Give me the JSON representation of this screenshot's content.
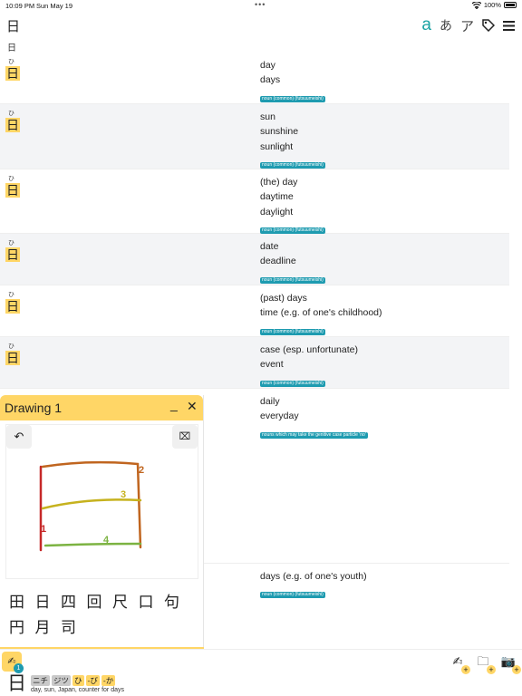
{
  "status": {
    "time": "10:09 PM",
    "date": "Sun May 19",
    "dots": "•••",
    "battery": "100%"
  },
  "toolbar": {
    "title": "日",
    "romaji": "a",
    "hiragana": "あ",
    "katakana": "ア",
    "tag": "⌗",
    "menu": "≡"
  },
  "query": "日",
  "results": [
    {
      "reading": "ひ",
      "kanji": "日",
      "glosses": [
        "day",
        "days"
      ],
      "pos": "noun (common) (futsuumeishi)"
    },
    {
      "reading": "ひ",
      "kanji": "日",
      "glosses": [
        "sun",
        "sunshine",
        "sunlight"
      ],
      "pos": "noun (common) (futsuumeishi)"
    },
    {
      "reading": "ひ",
      "kanji": "日",
      "glosses": [
        "(the) day",
        "daytime",
        "daylight"
      ],
      "pos": "noun (common) (futsuumeishi)"
    },
    {
      "reading": "ひ",
      "kanji": "日",
      "glosses": [
        "date",
        "deadline"
      ],
      "pos": "noun (common) (futsuumeishi)"
    },
    {
      "reading": "ひ",
      "kanji": "日",
      "glosses": [
        "(past) days",
        "time (e.g. of one's childhood)"
      ],
      "pos": "noun (common) (futsuumeishi)"
    },
    {
      "reading": "ひ",
      "kanji": "日",
      "glosses": [
        "case (esp. unfortunate)",
        "event"
      ],
      "pos": "noun (common) (futsuumeishi)"
    },
    {
      "reading": "",
      "kanji": "",
      "glosses": [
        "daily",
        "everyday"
      ],
      "pos": "nouns which may take the genitive case particle 'no'"
    },
    {
      "reading": "",
      "kanji": "",
      "glosses": [
        "days (e.g. of one's youth)"
      ],
      "pos": "noun (common) (futsuumeishi)"
    }
  ],
  "drawing": {
    "title": "Drawing 1",
    "minimize": "_",
    "close": "✕",
    "undo": "↶",
    "clear": "⌧",
    "stroke_numbers": [
      "1",
      "2",
      "3",
      "4"
    ],
    "candidates": [
      "田",
      "日",
      "四",
      "回",
      "尺",
      "口",
      "句",
      "円",
      "月",
      "司"
    ]
  },
  "bottom": {
    "pen": "✍",
    "badge": "1",
    "plus": "+",
    "icons": [
      "✍",
      "🗀",
      "📷"
    ],
    "selected_kanji": "日",
    "readings": [
      {
        "text": "ニチ",
        "type": "on"
      },
      {
        "text": "ジツ",
        "type": "on"
      },
      {
        "text": "ひ",
        "type": "kun"
      },
      {
        "text": "-び",
        "type": "kun"
      },
      {
        "text": "-か",
        "type": "kun"
      }
    ],
    "meaning": "day, sun, Japan, counter for days"
  },
  "colors": {
    "accent": "#ffd666",
    "teal": "#1e9bb0",
    "alt_row": "#f3f4f6"
  }
}
